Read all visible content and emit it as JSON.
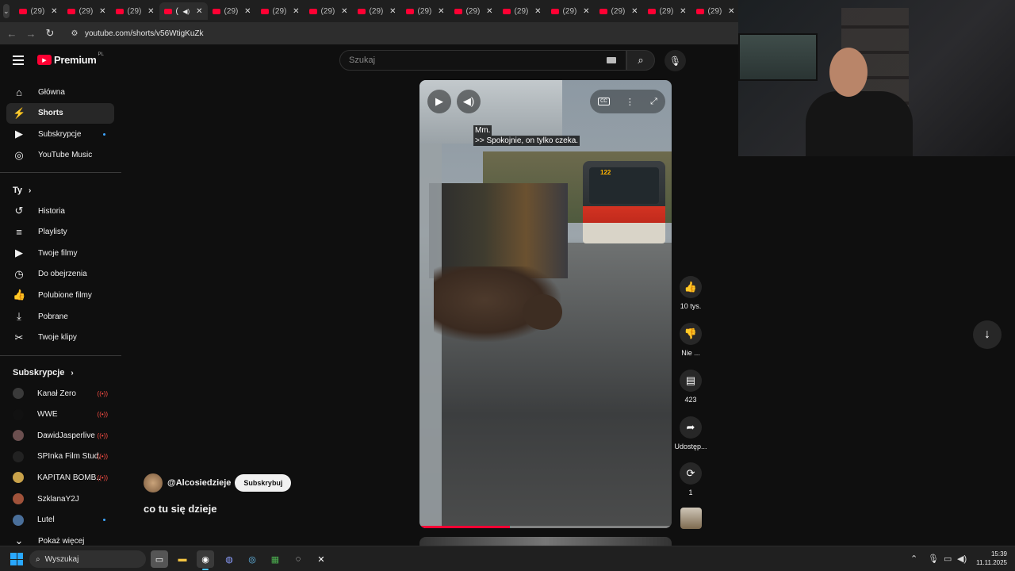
{
  "browser": {
    "tabs": [
      {
        "title": "(29)"
      },
      {
        "title": "(29)"
      },
      {
        "title": "(29)"
      },
      {
        "title": "(",
        "active": true
      },
      {
        "title": "(29)"
      },
      {
        "title": "(29)"
      },
      {
        "title": "(29)"
      },
      {
        "title": "(29)"
      },
      {
        "title": "(29)"
      },
      {
        "title": "(29)"
      },
      {
        "title": "(29)"
      },
      {
        "title": "(29)"
      },
      {
        "title": "(29)"
      },
      {
        "title": "(29)"
      },
      {
        "title": "(29)"
      }
    ],
    "url": "youtube.com/shorts/v56WtigKuZk"
  },
  "header": {
    "brand": "Premium",
    "region": "PL",
    "search_placeholder": "Szukaj"
  },
  "sidebar": {
    "main": [
      {
        "label": "Główna",
        "icon": "home-icon"
      },
      {
        "label": "Shorts",
        "icon": "shorts-icon",
        "active": true
      },
      {
        "label": "Subskrypcje",
        "icon": "subscriptions-icon",
        "dot": true
      },
      {
        "label": "YouTube Music",
        "icon": "music-icon"
      }
    ],
    "you_heading": "Ty",
    "you": [
      {
        "label": "Historia",
        "icon": "history-icon"
      },
      {
        "label": "Playlisty",
        "icon": "playlists-icon"
      },
      {
        "label": "Twoje filmy",
        "icon": "your-videos-icon"
      },
      {
        "label": "Do obejrzenia",
        "icon": "watch-later-icon"
      },
      {
        "label": "Polubione filmy",
        "icon": "liked-videos-icon"
      },
      {
        "label": "Pobrane",
        "icon": "downloads-icon"
      },
      {
        "label": "Twoje klipy",
        "icon": "clips-icon"
      }
    ],
    "subs_heading": "Subskrypcje",
    "subs": [
      {
        "label": "Kanał Zero",
        "status": "live",
        "avatar": "#3a3a3a"
      },
      {
        "label": "WWE",
        "status": "live",
        "avatar": "#111111"
      },
      {
        "label": "DawidJasperlive",
        "status": "live",
        "avatar": "#6b4f4f"
      },
      {
        "label": "SPInka Film Stud...",
        "status": "live",
        "avatar": "#222222"
      },
      {
        "label": "KAPITAN BOMB...",
        "status": "live",
        "avatar": "#c9a24a"
      },
      {
        "label": "SzklanaY2J",
        "status": "none",
        "avatar": "#a0523a"
      },
      {
        "label": "Lutel",
        "status": "dot",
        "avatar": "#4a6f9a"
      }
    ],
    "show_more": "Pokaż więcej"
  },
  "video": {
    "subtitle_line1": "Mm.",
    "subtitle_line2": ">> Spokojnie, on tylko czeka.",
    "bus_number": "122",
    "progress": 0.36,
    "channel": "@Alcosiedzieje",
    "subscribe": "Subskrybuj",
    "title": "co tu się dzieje"
  },
  "actions": {
    "likes": "10 tys.",
    "dislike": "Nie ...",
    "comments": "423",
    "share": "Udostęp...",
    "remix": "1"
  },
  "taskbar": {
    "search": "Wyszukaj",
    "time": "15:39",
    "date": "11.11.2025"
  }
}
